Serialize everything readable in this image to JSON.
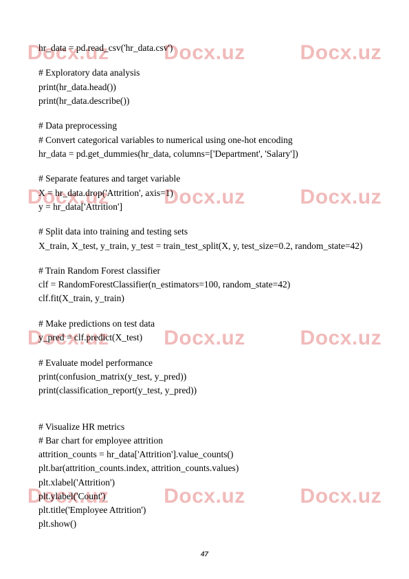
{
  "watermark_text": "Docx.uz",
  "page_number": "47",
  "code_lines": [
    "hr_data = pd.read_csv('hr_data.csv')",
    "",
    "# Exploratory data analysis",
    "print(hr_data.head())",
    "print(hr_data.describe())",
    "",
    "# Data preprocessing",
    "# Convert categorical variables to numerical using one-hot encoding",
    "hr_data = pd.get_dummies(hr_data, columns=['Department', 'Salary'])",
    "",
    "# Separate features and target variable",
    "X = hr_data.drop('Attrition', axis=1)",
    "y = hr_data['Attrition']",
    "",
    "# Split data into training and testing sets",
    "X_train, X_test, y_train, y_test = train_test_split(X, y, test_size=0.2, random_state=42)",
    "",
    "# Train Random Forest classifier",
    "clf = RandomForestClassifier(n_estimators=100, random_state=42)",
    "clf.fit(X_train, y_train)",
    "",
    "# Make predictions on test data",
    "y_pred = clf.predict(X_test)",
    "",
    "# Evaluate model performance",
    "print(confusion_matrix(y_test, y_pred))",
    "print(classification_report(y_test, y_pred))",
    "",
    "",
    "# Visualize HR metrics",
    "# Bar chart for employee attrition",
    "attrition_counts = hr_data['Attrition'].value_counts()",
    "plt.bar(attrition_counts.index, attrition_counts.values)",
    "plt.xlabel('Attrition')",
    "plt.ylabel('Count')",
    "plt.title('Employee Attrition')",
    "plt.show()"
  ]
}
